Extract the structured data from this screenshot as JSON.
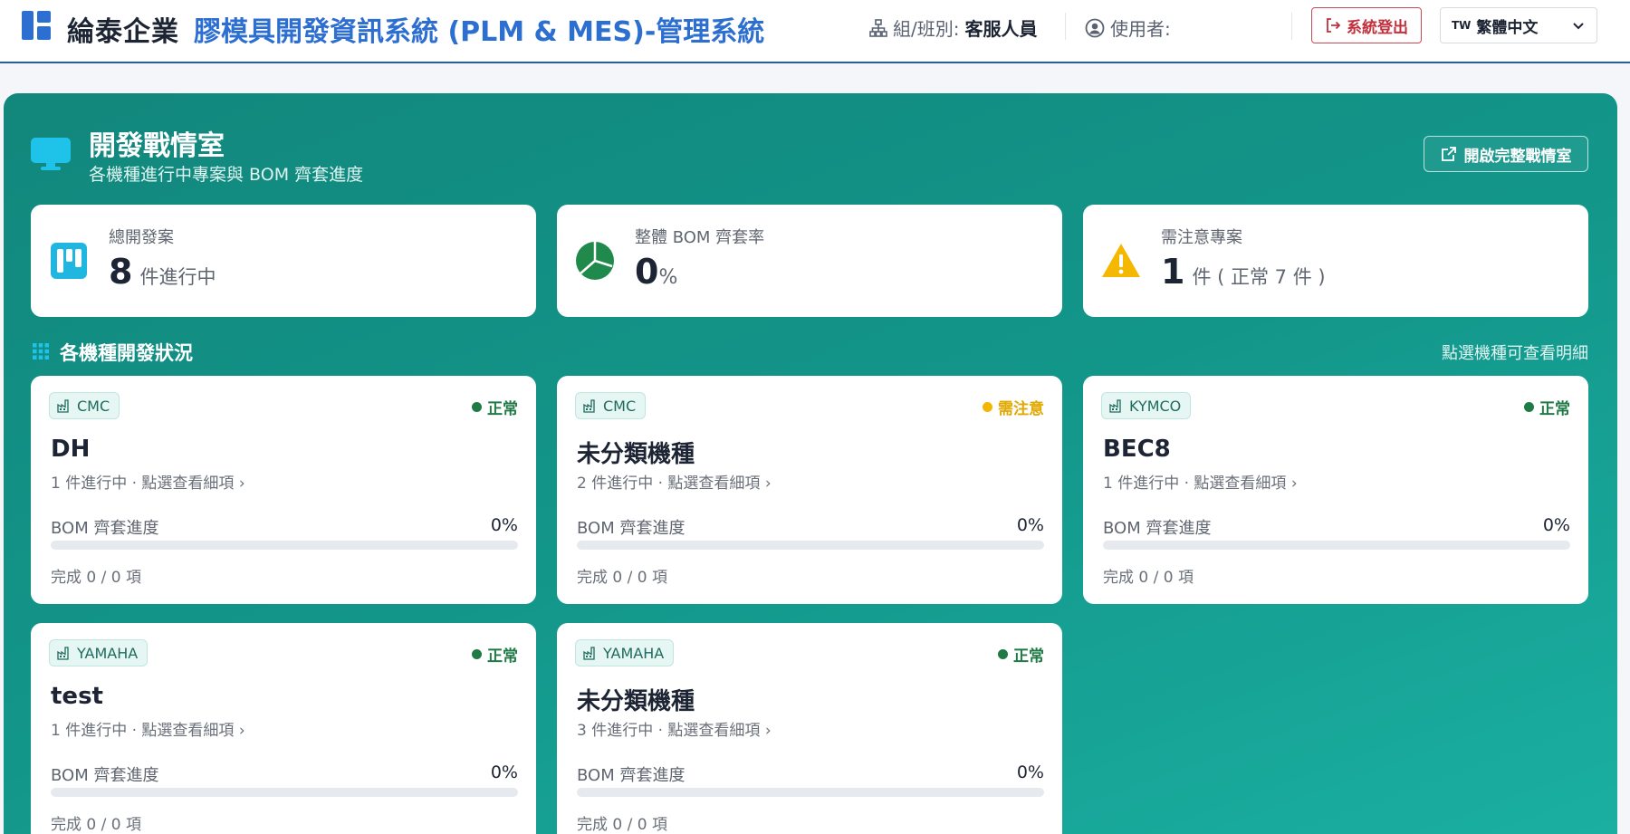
{
  "header": {
    "brand": "綸泰企業",
    "system_title": "膠模具開發資訊系統 (PLM & MES)-管理系統",
    "group_label": "組/班別:",
    "group_value": "客服人員",
    "user_label": "使用者:",
    "user_value": "",
    "logout_label": "系統登出",
    "language_flag": "TW",
    "language_label": "繁體中文",
    "logo_icon": "dashboard-layout-icon",
    "brand_color": "#2d6fd1"
  },
  "warroom": {
    "title": "開發戰情室",
    "subtitle": "各機種進行中專案與 BOM 齊套進度",
    "open_button_label": "開啟完整戰情室",
    "panel_color": "#13968a"
  },
  "stats": [
    {
      "label": "總開發案",
      "value": "8",
      "unit": "件進行中",
      "icon": "kanban-icon",
      "icon_color": "#1fb6e0"
    },
    {
      "label": "整體 BOM 齊套率",
      "value": "0",
      "unit": "%",
      "icon": "pie-chart-icon",
      "icon_color": "#1f8a4c"
    },
    {
      "label": "需注意專案",
      "value": "1",
      "unit": "件 ( 正常 7 件 )",
      "icon": "warning-icon",
      "icon_color": "#f5b800"
    }
  ],
  "section": {
    "title": "各機種開發狀況",
    "hint": "點選機種可查看明細"
  },
  "models": [
    {
      "brand": "CMC",
      "status": "正常",
      "status_type": "ok",
      "name": "DH",
      "summary": "1 件進行中 · 點選查看細項 ›",
      "bom_label": "BOM 齊套進度",
      "bom_pct": "0%",
      "bom_fraction": 0,
      "done": "完成 0 / 0 項"
    },
    {
      "brand": "CMC",
      "status": "需注意",
      "status_type": "warn",
      "name": "未分類機種",
      "summary": "2 件進行中 · 點選查看細項 ›",
      "bom_label": "BOM 齊套進度",
      "bom_pct": "0%",
      "bom_fraction": 0,
      "done": "完成 0 / 0 項"
    },
    {
      "brand": "KYMCO",
      "status": "正常",
      "status_type": "ok",
      "name": "BEC8",
      "summary": "1 件進行中 · 點選查看細項 ›",
      "bom_label": "BOM 齊套進度",
      "bom_pct": "0%",
      "bom_fraction": 0,
      "done": "完成 0 / 0 項"
    },
    {
      "brand": "YAMAHA",
      "status": "正常",
      "status_type": "ok",
      "name": "test",
      "summary": "1 件進行中 · 點選查看細項 ›",
      "bom_label": "BOM 齊套進度",
      "bom_pct": "0%",
      "bom_fraction": 0,
      "done": "完成 0 / 0 項"
    },
    {
      "brand": "YAMAHA",
      "status": "正常",
      "status_type": "ok",
      "name": "未分類機種",
      "summary": "3 件進行中 · 點選查看細項 ›",
      "bom_label": "BOM 齊套進度",
      "bom_pct": "0%",
      "bom_fraction": 0,
      "done": "完成 0 / 0 項"
    }
  ]
}
